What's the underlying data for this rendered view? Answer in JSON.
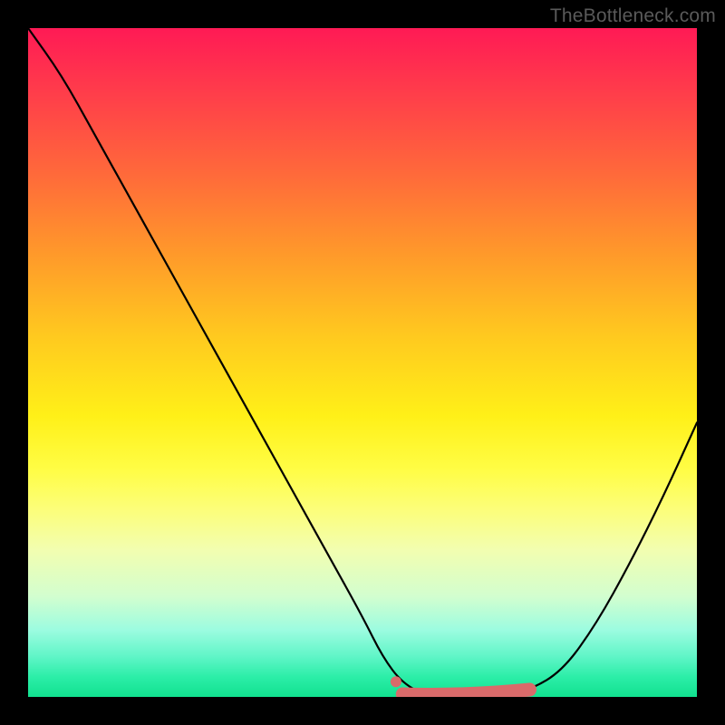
{
  "watermark": "TheBottleneck.com",
  "chart_data": {
    "type": "line",
    "title": "",
    "xlabel": "",
    "ylabel": "",
    "xlim": [
      0,
      100
    ],
    "ylim": [
      0,
      100
    ],
    "gradient_stops": [
      {
        "pos": 0,
        "color": "#ff1a55"
      },
      {
        "pos": 10,
        "color": "#ff3e4a"
      },
      {
        "pos": 22,
        "color": "#ff6a3a"
      },
      {
        "pos": 34,
        "color": "#ff9a2a"
      },
      {
        "pos": 46,
        "color": "#ffc91f"
      },
      {
        "pos": 58,
        "color": "#fff018"
      },
      {
        "pos": 66,
        "color": "#fffd45"
      },
      {
        "pos": 72,
        "color": "#fcfe7a"
      },
      {
        "pos": 78,
        "color": "#f2feb0"
      },
      {
        "pos": 85,
        "color": "#d2fecf"
      },
      {
        "pos": 90,
        "color": "#9cfce0"
      },
      {
        "pos": 94,
        "color": "#5ff5c7"
      },
      {
        "pos": 97,
        "color": "#2ceea8"
      },
      {
        "pos": 100,
        "color": "#11e18f"
      }
    ],
    "series": [
      {
        "name": "bottleneck-curve",
        "color": "#000000",
        "x": [
          0,
          5,
          10,
          15,
          20,
          25,
          30,
          35,
          40,
          45,
          50,
          53,
          56,
          60,
          65,
          70,
          75,
          80,
          85,
          90,
          95,
          100
        ],
        "y": [
          100,
          93,
          84,
          75,
          66,
          57,
          48,
          39,
          30,
          21,
          12,
          6,
          2,
          0,
          0,
          0,
          1,
          4,
          11,
          20,
          30,
          41
        ]
      }
    ],
    "highlight_band": {
      "name": "optimal-range",
      "color": "#d96a6a",
      "x_start": 56,
      "x_end": 75,
      "y": 0
    },
    "marker": {
      "name": "start-marker",
      "color": "#d96a6a",
      "x": 55,
      "y": 2,
      "radius": 6
    }
  }
}
